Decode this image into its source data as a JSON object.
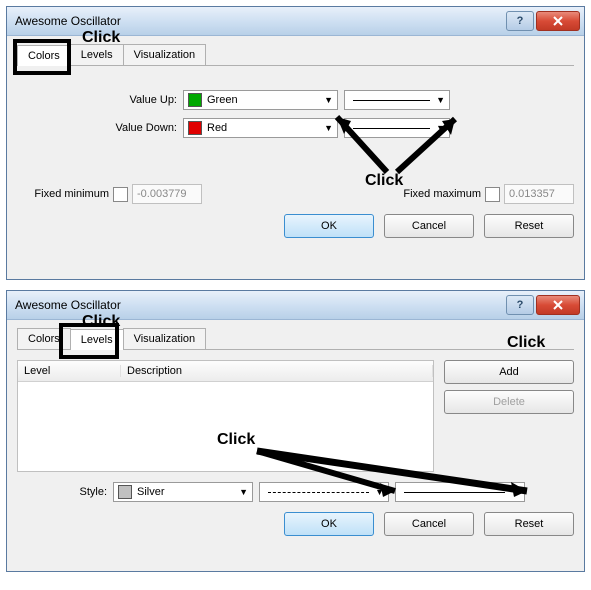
{
  "dialog1": {
    "title": "Awesome Oscillator",
    "tabs": [
      "Colors",
      "Levels",
      "Visualization"
    ],
    "active_tab": 0,
    "value_up_label": "Value Up:",
    "value_up_color_name": "Green",
    "value_up_color_hex": "#00a800",
    "value_down_label": "Value Down:",
    "value_down_color_name": "Red",
    "value_down_color_hex": "#e00000",
    "fixed_min_label": "Fixed minimum",
    "fixed_min_value": "-0.003779",
    "fixed_max_label": "Fixed maximum",
    "fixed_max_value": "0.013357",
    "ok": "OK",
    "cancel": "Cancel",
    "reset": "Reset",
    "click_annotations": [
      "Click",
      "Click"
    ]
  },
  "dialog2": {
    "title": "Awesome Oscillator",
    "tabs": [
      "Colors",
      "Levels",
      "Visualization"
    ],
    "active_tab": 1,
    "table_headers": [
      "Level",
      "Description"
    ],
    "add": "Add",
    "delete": "Delete",
    "style_label": "Style:",
    "style_color_name": "Silver",
    "style_color_hex": "#c0c0c0",
    "ok": "OK",
    "cancel": "Cancel",
    "reset": "Reset",
    "click_annotations": [
      "Click",
      "Click",
      "Click"
    ]
  }
}
